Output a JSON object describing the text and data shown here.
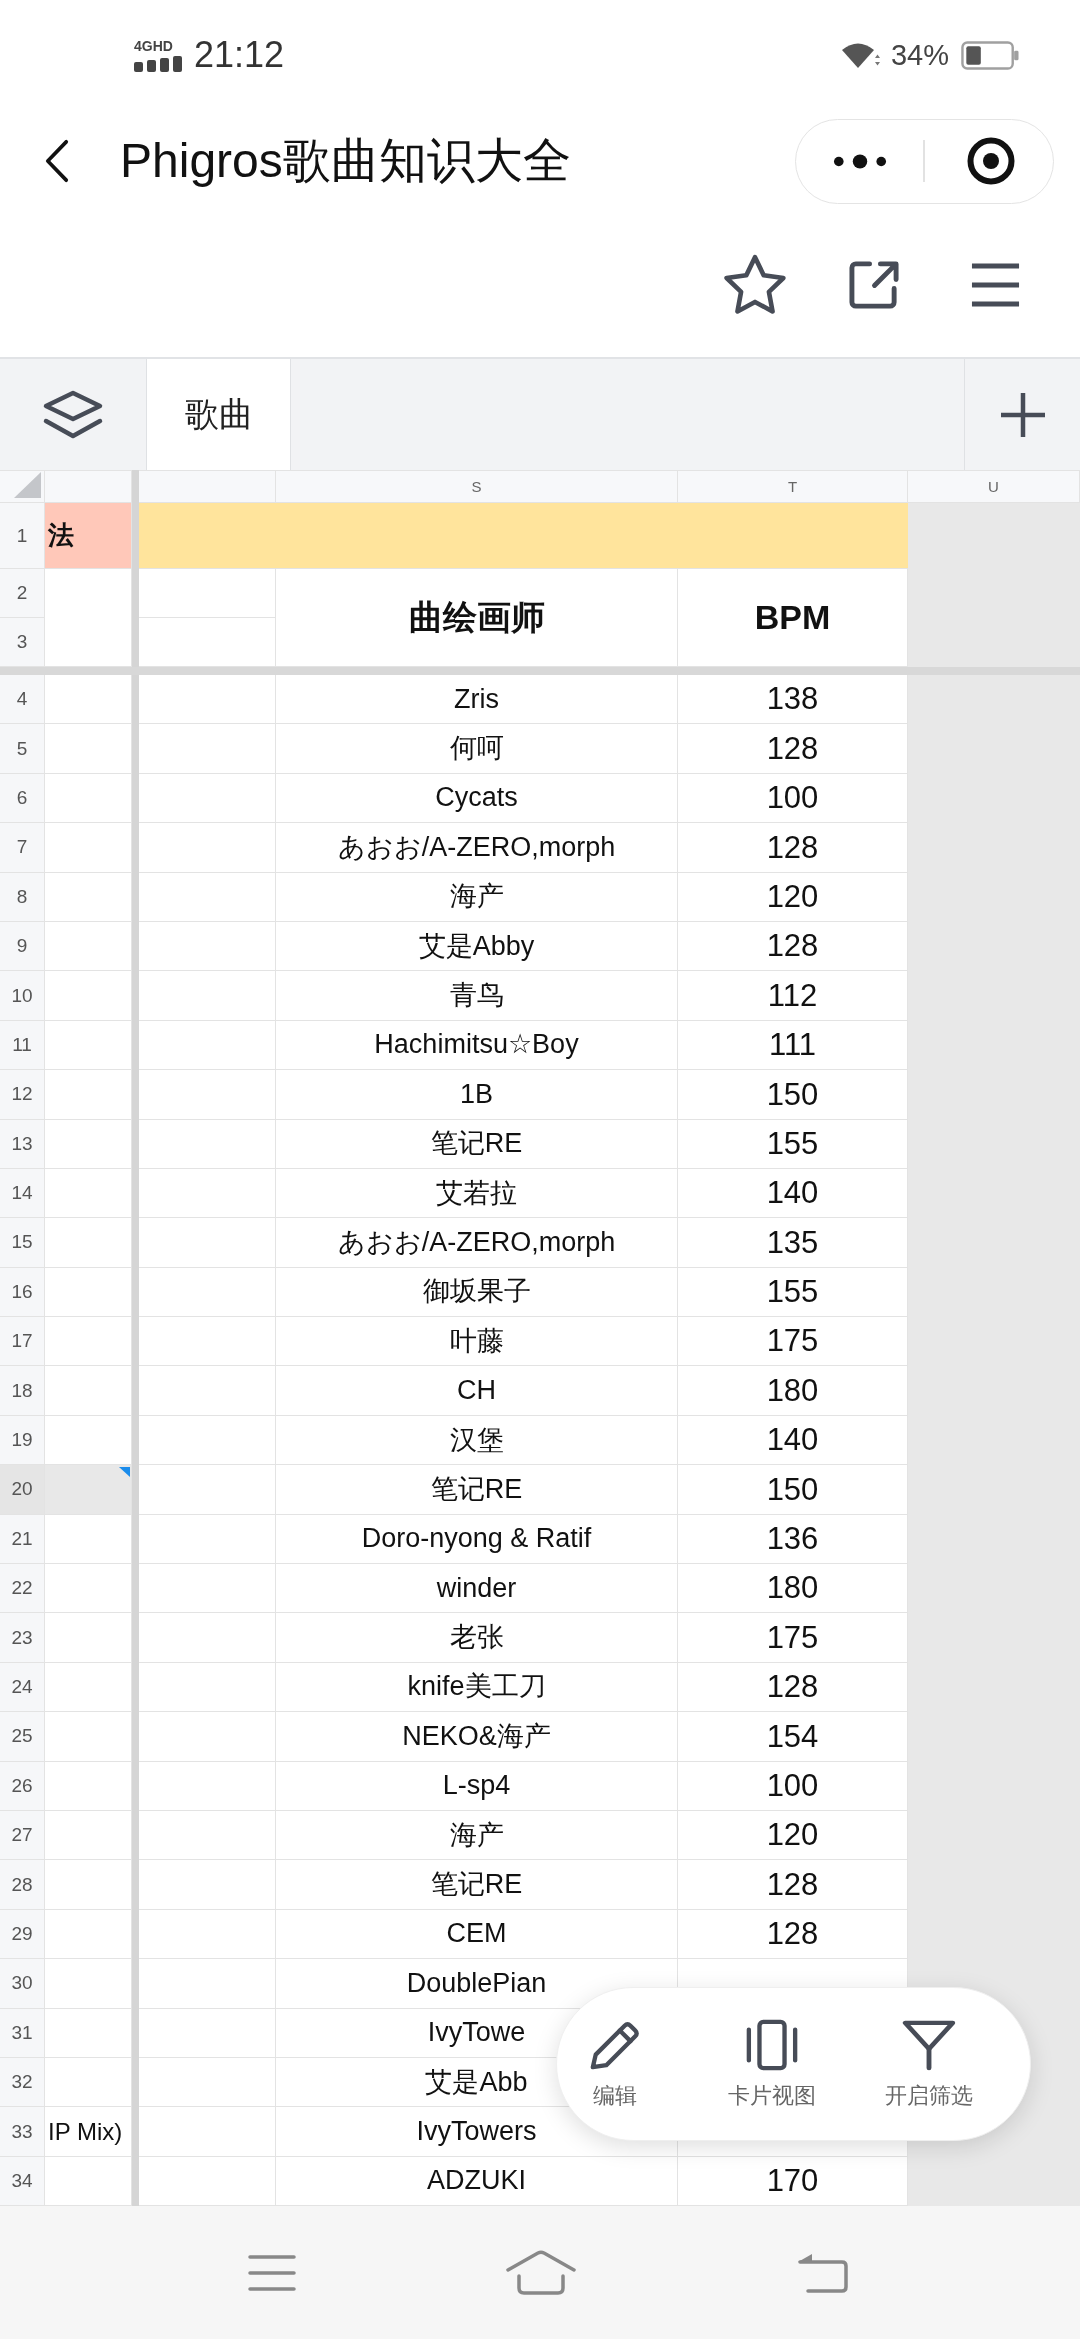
{
  "status_bar": {
    "network": "4GHD",
    "time": "21:12",
    "battery": "34%"
  },
  "header": {
    "title": "Phigros歌曲知识大全"
  },
  "sheet_tabs": [
    {
      "label": "歌曲",
      "selected": true
    }
  ],
  "sheet": {
    "column_letters": [
      "S",
      "T",
      "U"
    ],
    "row_1": {
      "number": "1",
      "column_1": "法"
    },
    "heading_rows": {
      "numbers": [
        "2",
        "3"
      ],
      "headings": [
        "曲绘画师",
        "BPM"
      ]
    },
    "rows": [
      {
        "number": "4",
        "illustrator": "Zris",
        "bpm": "138",
        "selected": false,
        "has_comment": false
      },
      {
        "number": "5",
        "illustrator": "何呵",
        "bpm": "128",
        "selected": false,
        "has_comment": false
      },
      {
        "number": "6",
        "illustrator": "Cycats",
        "bpm": "100",
        "selected": false,
        "has_comment": false
      },
      {
        "number": "7",
        "illustrator": "あおお/A-ZERO,morph",
        "bpm": "128",
        "selected": false,
        "has_comment": false
      },
      {
        "number": "8",
        "illustrator": "海产",
        "bpm": "120",
        "selected": false,
        "has_comment": false
      },
      {
        "number": "9",
        "illustrator": "艾是Abby",
        "bpm": "128",
        "selected": false,
        "has_comment": false
      },
      {
        "number": "10",
        "illustrator": "青鸟",
        "bpm": "112",
        "selected": false,
        "has_comment": false
      },
      {
        "number": "11",
        "illustrator": "Hachimitsu☆Boy",
        "bpm": "111",
        "selected": false,
        "has_comment": false
      },
      {
        "number": "12",
        "illustrator": "1B",
        "bpm": "150",
        "selected": false,
        "has_comment": false
      },
      {
        "number": "13",
        "illustrator": "笔记RE",
        "bpm": "155",
        "selected": false,
        "has_comment": false
      },
      {
        "number": "14",
        "illustrator": "艾若拉",
        "bpm": "140",
        "selected": false,
        "has_comment": false
      },
      {
        "number": "15",
        "illustrator": "あおお/A-ZERO,morph",
        "bpm": "135",
        "selected": false,
        "has_comment": false
      },
      {
        "number": "16",
        "illustrator": "御坂果子",
        "bpm": "155",
        "selected": false,
        "has_comment": false
      },
      {
        "number": "17",
        "illustrator": "叶藤",
        "bpm": "175",
        "selected": false,
        "has_comment": false
      },
      {
        "number": "18",
        "illustrator": "CH",
        "bpm": "180",
        "selected": false,
        "has_comment": false
      },
      {
        "number": "19",
        "illustrator": "汉堡",
        "bpm": "140",
        "selected": false,
        "has_comment": false
      },
      {
        "number": "20",
        "illustrator": "笔记RE",
        "bpm": "150",
        "selected": true,
        "has_comment": true
      },
      {
        "number": "21",
        "illustrator": "Doro-nyong & Ratif",
        "bpm": "136",
        "selected": false,
        "has_comment": false
      },
      {
        "number": "22",
        "illustrator": "winder",
        "bpm": "180",
        "selected": false,
        "has_comment": false
      },
      {
        "number": "23",
        "illustrator": "老张",
        "bpm": "175",
        "selected": false,
        "has_comment": false
      },
      {
        "number": "24",
        "illustrator": "knife美工刀",
        "bpm": "128",
        "selected": false,
        "has_comment": false
      },
      {
        "number": "25",
        "illustrator": "NEKO&海产",
        "bpm": "154",
        "selected": false,
        "has_comment": false
      },
      {
        "number": "26",
        "illustrator": "L-sp4",
        "bpm": "100",
        "selected": false,
        "has_comment": false
      },
      {
        "number": "27",
        "illustrator": "海产",
        "bpm": "120",
        "selected": false,
        "has_comment": false
      },
      {
        "number": "28",
        "illustrator": "笔记RE",
        "bpm": "128",
        "selected": false,
        "has_comment": false
      },
      {
        "number": "29",
        "illustrator": "CEM",
        "bpm": "128",
        "selected": false,
        "has_comment": false
      },
      {
        "number": "30",
        "illustrator": "DoublePian",
        "selected": false,
        "has_comment": false
      },
      {
        "number": "31",
        "illustrator": "IvyTowe",
        "selected": false,
        "has_comment": false
      },
      {
        "number": "32",
        "illustrator": "艾是Abb",
        "selected": false,
        "has_comment": false
      },
      {
        "number": "33",
        "column_1": "IP Mix)",
        "illustrator": "IvyTowers",
        "selected": false,
        "has_comment": false
      },
      {
        "number": "34",
        "illustrator": "ADZUKI",
        "bpm": "170",
        "selected": false,
        "has_comment": false
      }
    ]
  },
  "floating_toolbar": {
    "actions": [
      "编辑",
      "卡片视图",
      "开启筛选"
    ]
  }
}
